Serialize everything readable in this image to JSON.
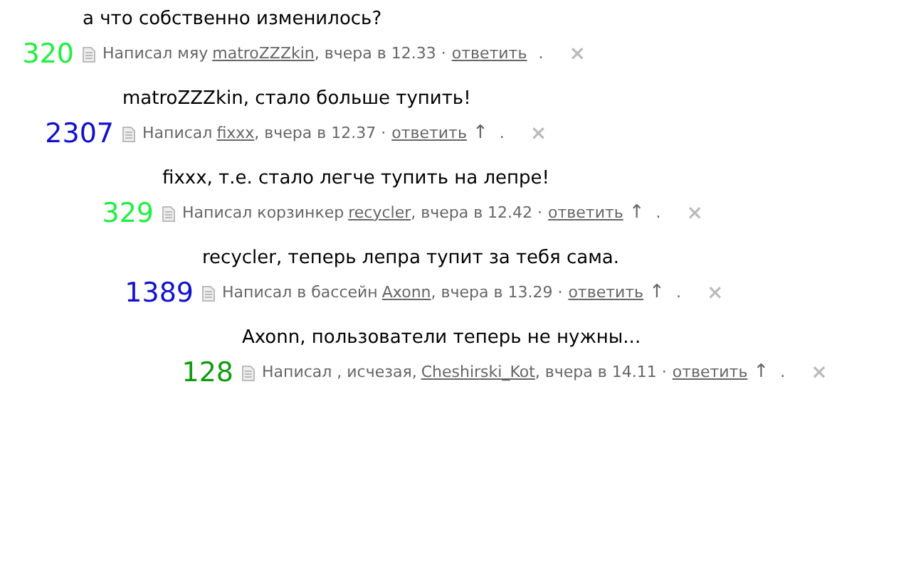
{
  "comments": [
    {
      "text": "а что собственно изменилось?",
      "score": "320",
      "color": "#22ee44",
      "prefix": "Написал мяу",
      "author": "matroZZZkin",
      "when": ", вчера в 12.33 ·",
      "reply": "ответить",
      "dot": ".",
      "delete": "×",
      "children": [
        {
          "text": "matroZZZkin, стало больше тупить!",
          "score": "2307",
          "color": "#1111cc",
          "prefix": "Написал",
          "author": "fixxx",
          "when": ", вчера в 12.37 ·",
          "reply": "ответить",
          "parent_arrow": "↑",
          "dot": ".",
          "delete": "×",
          "children": [
            {
              "text": "fixxx, т.е. стало легче тупить на лепре!",
              "score": "329",
              "color": "#22ee44",
              "prefix": "Написал корзинкер",
              "author": "recycler",
              "when": ", вчера в 12.42 ·",
              "reply": "ответить",
              "parent_arrow": "↑",
              "dot": ".",
              "delete": "×",
              "children": [
                {
                  "text": "recycler, теперь лепра тупит за тебя сама.",
                  "score": "1389",
                  "color": "#1111cc",
                  "prefix": "Написал в бассейн",
                  "author": "Axonn",
                  "when": ", вчера в 13.29 ·",
                  "reply": "ответить",
                  "parent_arrow": "↑",
                  "dot": ".",
                  "delete": "×",
                  "children": [
                    {
                      "text": "Axonn, пользователи теперь не нужны...",
                      "score": "128",
                      "color": "#119911",
                      "prefix": "Написал , исчезая,",
                      "author": "Cheshirski_Kot",
                      "when": ", вчера в 14.11 ·",
                      "reply": "ответить",
                      "parent_arrow": "↑",
                      "dot": ".",
                      "delete": "×"
                    }
                  ]
                }
              ]
            }
          ]
        }
      ]
    }
  ]
}
